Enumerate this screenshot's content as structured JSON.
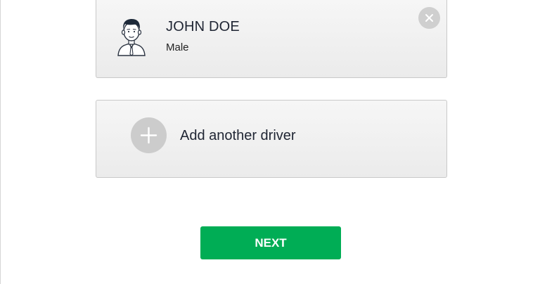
{
  "driver": {
    "name": "JOHN DOE",
    "gender": "Male",
    "avatar_icon": "male-avatar-icon",
    "remove_icon": "close-icon"
  },
  "add_driver": {
    "label": "Add another driver",
    "icon": "plus-icon"
  },
  "next_button": {
    "label": "NEXT",
    "color": "#00ad55"
  },
  "colors": {
    "card_border": "#c9c9c9",
    "icon_circle": "#cccccc",
    "text": "#1f2533"
  }
}
